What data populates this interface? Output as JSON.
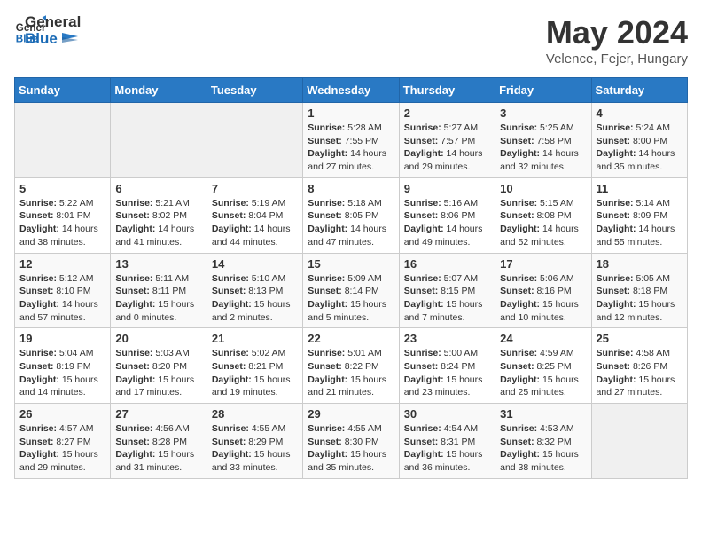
{
  "header": {
    "logo_general": "General",
    "logo_blue": "Blue",
    "title": "May 2024",
    "subtitle": "Velence, Fejer, Hungary"
  },
  "weekdays": [
    "Sunday",
    "Monday",
    "Tuesday",
    "Wednesday",
    "Thursday",
    "Friday",
    "Saturday"
  ],
  "weeks": [
    [
      {
        "day": "",
        "empty": true
      },
      {
        "day": "",
        "empty": true
      },
      {
        "day": "",
        "empty": true
      },
      {
        "day": "1",
        "sunrise": "5:28 AM",
        "sunset": "7:55 PM",
        "daylight": "14 hours and 27 minutes."
      },
      {
        "day": "2",
        "sunrise": "5:27 AM",
        "sunset": "7:57 PM",
        "daylight": "14 hours and 29 minutes."
      },
      {
        "day": "3",
        "sunrise": "5:25 AM",
        "sunset": "7:58 PM",
        "daylight": "14 hours and 32 minutes."
      },
      {
        "day": "4",
        "sunrise": "5:24 AM",
        "sunset": "8:00 PM",
        "daylight": "14 hours and 35 minutes."
      }
    ],
    [
      {
        "day": "5",
        "sunrise": "5:22 AM",
        "sunset": "8:01 PM",
        "daylight": "14 hours and 38 minutes."
      },
      {
        "day": "6",
        "sunrise": "5:21 AM",
        "sunset": "8:02 PM",
        "daylight": "14 hours and 41 minutes."
      },
      {
        "day": "7",
        "sunrise": "5:19 AM",
        "sunset": "8:04 PM",
        "daylight": "14 hours and 44 minutes."
      },
      {
        "day": "8",
        "sunrise": "5:18 AM",
        "sunset": "8:05 PM",
        "daylight": "14 hours and 47 minutes."
      },
      {
        "day": "9",
        "sunrise": "5:16 AM",
        "sunset": "8:06 PM",
        "daylight": "14 hours and 49 minutes."
      },
      {
        "day": "10",
        "sunrise": "5:15 AM",
        "sunset": "8:08 PM",
        "daylight": "14 hours and 52 minutes."
      },
      {
        "day": "11",
        "sunrise": "5:14 AM",
        "sunset": "8:09 PM",
        "daylight": "14 hours and 55 minutes."
      }
    ],
    [
      {
        "day": "12",
        "sunrise": "5:12 AM",
        "sunset": "8:10 PM",
        "daylight": "14 hours and 57 minutes."
      },
      {
        "day": "13",
        "sunrise": "5:11 AM",
        "sunset": "8:11 PM",
        "daylight": "15 hours and 0 minutes."
      },
      {
        "day": "14",
        "sunrise": "5:10 AM",
        "sunset": "8:13 PM",
        "daylight": "15 hours and 2 minutes."
      },
      {
        "day": "15",
        "sunrise": "5:09 AM",
        "sunset": "8:14 PM",
        "daylight": "15 hours and 5 minutes."
      },
      {
        "day": "16",
        "sunrise": "5:07 AM",
        "sunset": "8:15 PM",
        "daylight": "15 hours and 7 minutes."
      },
      {
        "day": "17",
        "sunrise": "5:06 AM",
        "sunset": "8:16 PM",
        "daylight": "15 hours and 10 minutes."
      },
      {
        "day": "18",
        "sunrise": "5:05 AM",
        "sunset": "8:18 PM",
        "daylight": "15 hours and 12 minutes."
      }
    ],
    [
      {
        "day": "19",
        "sunrise": "5:04 AM",
        "sunset": "8:19 PM",
        "daylight": "15 hours and 14 minutes."
      },
      {
        "day": "20",
        "sunrise": "5:03 AM",
        "sunset": "8:20 PM",
        "daylight": "15 hours and 17 minutes."
      },
      {
        "day": "21",
        "sunrise": "5:02 AM",
        "sunset": "8:21 PM",
        "daylight": "15 hours and 19 minutes."
      },
      {
        "day": "22",
        "sunrise": "5:01 AM",
        "sunset": "8:22 PM",
        "daylight": "15 hours and 21 minutes."
      },
      {
        "day": "23",
        "sunrise": "5:00 AM",
        "sunset": "8:24 PM",
        "daylight": "15 hours and 23 minutes."
      },
      {
        "day": "24",
        "sunrise": "4:59 AM",
        "sunset": "8:25 PM",
        "daylight": "15 hours and 25 minutes."
      },
      {
        "day": "25",
        "sunrise": "4:58 AM",
        "sunset": "8:26 PM",
        "daylight": "15 hours and 27 minutes."
      }
    ],
    [
      {
        "day": "26",
        "sunrise": "4:57 AM",
        "sunset": "8:27 PM",
        "daylight": "15 hours and 29 minutes."
      },
      {
        "day": "27",
        "sunrise": "4:56 AM",
        "sunset": "8:28 PM",
        "daylight": "15 hours and 31 minutes."
      },
      {
        "day": "28",
        "sunrise": "4:55 AM",
        "sunset": "8:29 PM",
        "daylight": "15 hours and 33 minutes."
      },
      {
        "day": "29",
        "sunrise": "4:55 AM",
        "sunset": "8:30 PM",
        "daylight": "15 hours and 35 minutes."
      },
      {
        "day": "30",
        "sunrise": "4:54 AM",
        "sunset": "8:31 PM",
        "daylight": "15 hours and 36 minutes."
      },
      {
        "day": "31",
        "sunrise": "4:53 AM",
        "sunset": "8:32 PM",
        "daylight": "15 hours and 38 minutes."
      },
      {
        "day": "",
        "empty": true
      }
    ]
  ],
  "labels": {
    "sunrise": "Sunrise:",
    "sunset": "Sunset:",
    "daylight": "Daylight:"
  }
}
